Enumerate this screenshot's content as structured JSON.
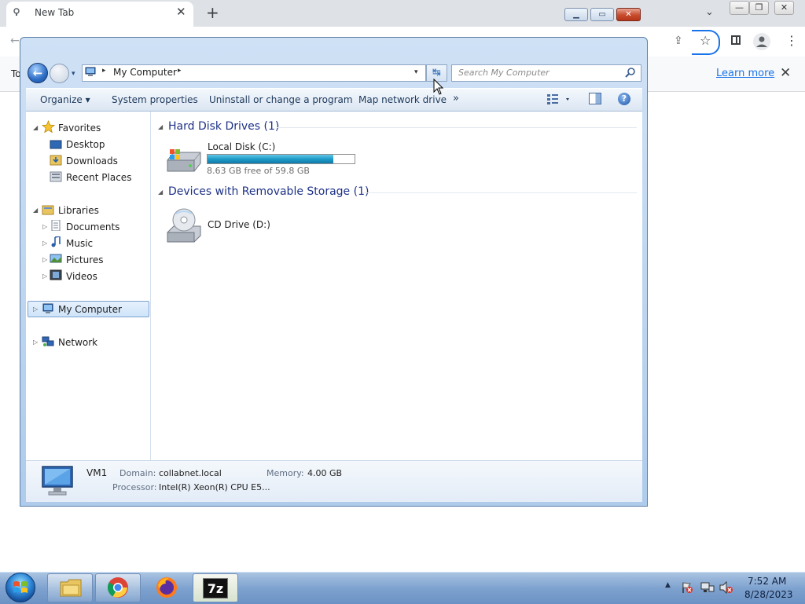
{
  "chrome": {
    "tab_title": "New Tab",
    "tab_close": "✕",
    "new_tab": "+",
    "tab_search": "⌄",
    "min": "—",
    "max": "❐",
    "close": "✕",
    "infobar_left": "To",
    "learn_more": "Learn more",
    "infobar_close": "✕",
    "share_icon": "⇪",
    "star_icon": "☆",
    "menu_icon": "⋮",
    "back_icon": "←",
    "accent_color": "#1a73e8"
  },
  "explorer": {
    "back_arrow": "←",
    "history_arrow": "▾",
    "address": {
      "sep1": "▸",
      "location": "My Computer",
      "sep2": "▸",
      "dropdown": "▾"
    },
    "refresh_icon": "↹",
    "search_placeholder": "Search My Computer",
    "commands": {
      "organize": "Organize ▾",
      "system_properties": "System properties",
      "uninstall": "Uninstall or change a program",
      "map_drive": "Map network drive",
      "more": "»",
      "help": "?"
    },
    "nav": {
      "favorites": "Favorites",
      "desktop": "Desktop",
      "downloads": "Downloads",
      "recent_places": "Recent Places",
      "libraries": "Libraries",
      "documents": "Documents",
      "music": "Music",
      "pictures": "Pictures",
      "videos": "Videos",
      "my_computer": "My Computer",
      "network": "Network"
    },
    "groups": {
      "hdd_title": "Hard Disk Drives (1)",
      "removable_title": "Devices with Removable Storage (1)"
    },
    "drives": {
      "c_name": "Local Disk (C:)",
      "c_free": "8.63 GB free of 59.8 GB",
      "c_used_fraction": 0.856,
      "d_name": "CD Drive (D:)"
    },
    "details": {
      "computer_name": "VM1",
      "domain_label": "Domain:",
      "domain_value": "collabnet.local",
      "memory_label": "Memory:",
      "memory_value": "4.00 GB",
      "processor_label": "Processor:",
      "processor_value": "Intel(R) Xeon(R) CPU E5..."
    }
  },
  "taskbar": {
    "seven_zip_label": "7z",
    "tray_arrow": "▲",
    "time": "7:52 AM",
    "date": "8/28/2023"
  }
}
